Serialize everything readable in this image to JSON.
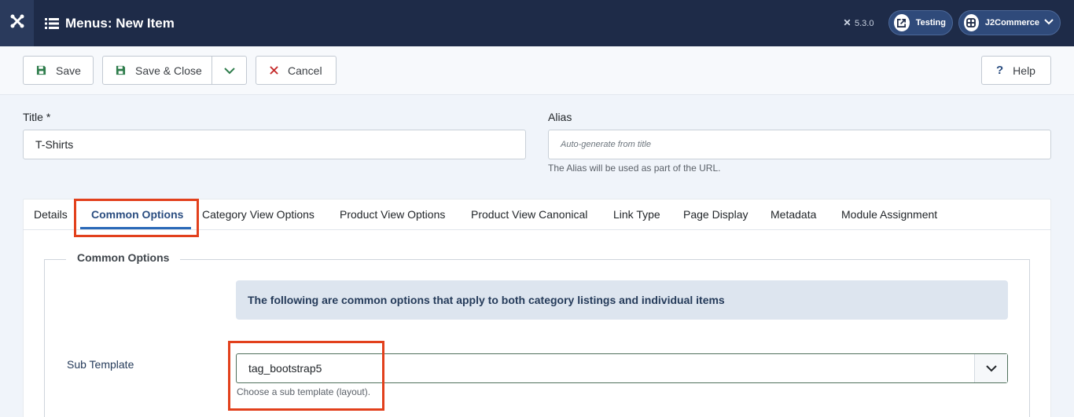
{
  "header": {
    "title": "Menus: New Item",
    "version": "5.3.0",
    "site_pill": "Testing",
    "user_pill": "J2Commerce"
  },
  "toolbar": {
    "save_label": "Save",
    "save_close_label": "Save & Close",
    "cancel_label": "Cancel",
    "help_label": "Help"
  },
  "form": {
    "title_label": "Title *",
    "title_value": "T-Shirts",
    "alias_label": "Alias",
    "alias_placeholder": "Auto-generate from title",
    "alias_hint": "The Alias will be used as part of the URL."
  },
  "tabs": [
    {
      "label": "Details"
    },
    {
      "label": "Common Options",
      "active": true
    },
    {
      "label": "Category View Options"
    },
    {
      "label": "Product View Options"
    },
    {
      "label": "Product View Canonical"
    },
    {
      "label": "Link Type"
    },
    {
      "label": "Page Display"
    },
    {
      "label": "Metadata"
    },
    {
      "label": "Module Assignment"
    }
  ],
  "common_options": {
    "legend": "Common Options",
    "info": "The following are common options that apply to both category listings and individual items",
    "sub_template_label": "Sub Template",
    "sub_template_value": "tag_bootstrap5",
    "sub_template_hint": "Choose a sub template (layout)."
  },
  "colors": {
    "header_bg": "#1e2b48",
    "highlight": "#e2401c",
    "active_tab": "#2a69b8"
  },
  "icons": [
    "joomla-icon",
    "list-icon",
    "external-link-icon",
    "grid-icon",
    "chevron-down-icon",
    "save-icon",
    "close-icon",
    "help-icon"
  ]
}
